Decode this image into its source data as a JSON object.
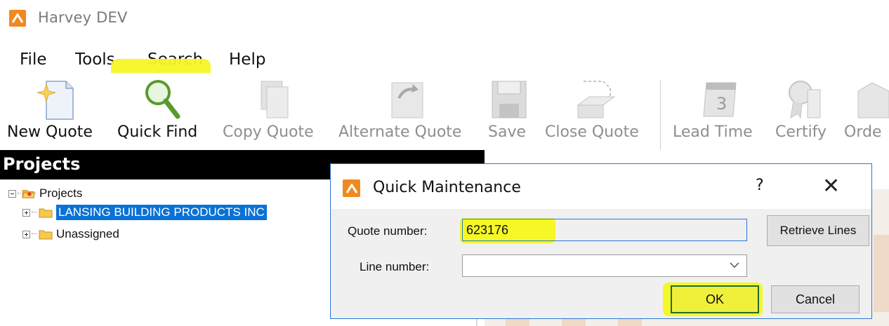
{
  "window": {
    "title": "Harvey DEV"
  },
  "menu": {
    "items": [
      "File",
      "Tools",
      "Search",
      "Help"
    ]
  },
  "toolbar": {
    "buttons": [
      {
        "label": "New Quote",
        "icon": "new-quote-icon",
        "enabled": true
      },
      {
        "label": "Quick Find",
        "icon": "magnifier-icon",
        "enabled": true,
        "highlighted": true
      },
      {
        "label": "Copy Quote",
        "icon": "copy-quote-icon",
        "enabled": false
      },
      {
        "label": "Alternate Quote",
        "icon": "alternate-quote-icon",
        "enabled": false
      },
      {
        "label": "Save",
        "icon": "save-icon",
        "enabled": false
      },
      {
        "label": "Close Quote",
        "icon": "close-quote-icon",
        "enabled": false
      },
      {
        "label": "Lead Time",
        "icon": "calendar-icon",
        "enabled": false
      },
      {
        "label": "Certify",
        "icon": "certify-icon",
        "enabled": false
      },
      {
        "label": "Orde",
        "icon": "order-icon",
        "enabled": false
      }
    ]
  },
  "projects": {
    "header": "Projects",
    "tree": [
      {
        "label": "Projects",
        "level": 0,
        "expanded": true
      },
      {
        "label": "LANSING BUILDING PRODUCTS INC",
        "level": 1,
        "selected": true
      },
      {
        "label": "Unassigned",
        "level": 1
      }
    ]
  },
  "dialog": {
    "title": "Quick Maintenance",
    "help_glyph": "?",
    "close_glyph": "✕",
    "quote_label": "Quote number:",
    "quote_value": "623176",
    "line_label": "Line number:",
    "line_value": "",
    "retrieve_label": "Retrieve Lines",
    "ok_label": "OK",
    "cancel_label": "Cancel"
  },
  "colors": {
    "accent": "#f08a1f",
    "selection": "#0a72d6",
    "highlight": "#f5f726",
    "dialog_border": "#2b78d4"
  }
}
